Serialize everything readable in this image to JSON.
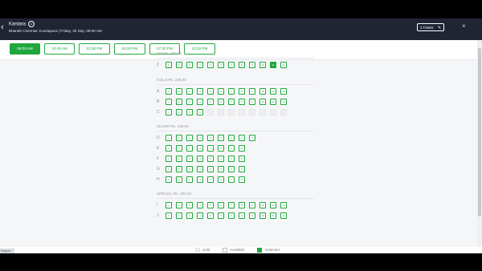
{
  "header": {
    "movie_title": "Kantara",
    "badge": "U",
    "subtitle": "Bharath Cinemas: Kundapura | Friday, 30 Sep, 08:00 AM",
    "tickets_label": "2 Tickets",
    "back_symbol": "‹",
    "pencil_symbol": "✎",
    "close_symbol": "×"
  },
  "showtimes": [
    "08:00 AM",
    "10:45 AM",
    "01:30 PM",
    "04:20 PM",
    "07:30 PM",
    "10:15 PM"
  ],
  "selected_showtime": "08:00 AM",
  "categories": [
    {
      "title": "VIP-Rs. 400.00",
      "rows": [
        {
          "label": "Z",
          "seats": [
            "1",
            "2",
            "3",
            "4",
            "5",
            "6",
            "7",
            "8",
            "9",
            "10",
            "11",
            "12"
          ],
          "selected": [
            "11"
          ],
          "sold": []
        }
      ]
    },
    {
      "title": "GOLD-Rs. 236.00",
      "rows": [
        {
          "label": "A",
          "seats": [
            "1",
            "2",
            "3",
            "4",
            "5",
            "6",
            "7",
            "8",
            "9",
            "10",
            "11",
            "12"
          ],
          "selected": [],
          "sold": []
        },
        {
          "label": "B",
          "seats": [
            "1",
            "2",
            "3",
            "4",
            "5",
            "6",
            "7",
            "8",
            "9",
            "10",
            "11",
            "12"
          ],
          "selected": [],
          "sold": []
        },
        {
          "label": "C",
          "seats": [
            "1",
            "2",
            "3",
            "4",
            "5",
            "6",
            "7",
            "8",
            "9",
            "10",
            "11",
            "12"
          ],
          "selected": [],
          "sold": [
            "5",
            "6",
            "7",
            "8",
            "9",
            "10",
            "11",
            "12"
          ]
        }
      ]
    },
    {
      "title": "SILVER-Rs. 236.00",
      "rows": [
        {
          "label": "D",
          "seats": [
            "1",
            "2",
            "3",
            "4",
            "5",
            "6",
            "7",
            "8",
            "9"
          ],
          "selected": [],
          "sold": []
        },
        {
          "label": "E",
          "seats": [
            "1",
            "2",
            "3",
            "4",
            "5",
            "6",
            "7",
            "8"
          ],
          "selected": [],
          "sold": []
        },
        {
          "label": "F",
          "seats": [
            "1",
            "2",
            "3",
            "4",
            "5",
            "6",
            "7",
            "8"
          ],
          "selected": [],
          "sold": []
        },
        {
          "label": "G",
          "seats": [
            "1",
            "2",
            "3",
            "4",
            "5",
            "6",
            "7",
            "8"
          ],
          "selected": [],
          "sold": []
        },
        {
          "label": "H",
          "seats": [
            "1",
            "2",
            "3",
            "4",
            "5",
            "6",
            "7",
            "8"
          ],
          "selected": [],
          "sold": []
        }
      ]
    },
    {
      "title": "SPECIAL-Rs. 236.00",
      "rows": [
        {
          "label": "I",
          "seats": [
            "1",
            "2",
            "3",
            "4",
            "5",
            "6",
            "7",
            "8",
            "9",
            "10",
            "11",
            "12"
          ],
          "selected": [],
          "sold": []
        },
        {
          "label": "J",
          "seats": [
            "1",
            "2",
            "3",
            "4",
            "5",
            "6",
            "7",
            "8",
            "9",
            "10",
            "11",
            "12"
          ],
          "selected": [],
          "sold": []
        }
      ]
    }
  ],
  "legend": {
    "sold": "Sold",
    "available": "Available",
    "selected": "Selected"
  },
  "bottom_label": "Support",
  "colors": {
    "accent": "#1ea83c",
    "header_bg": "#1f2533"
  }
}
